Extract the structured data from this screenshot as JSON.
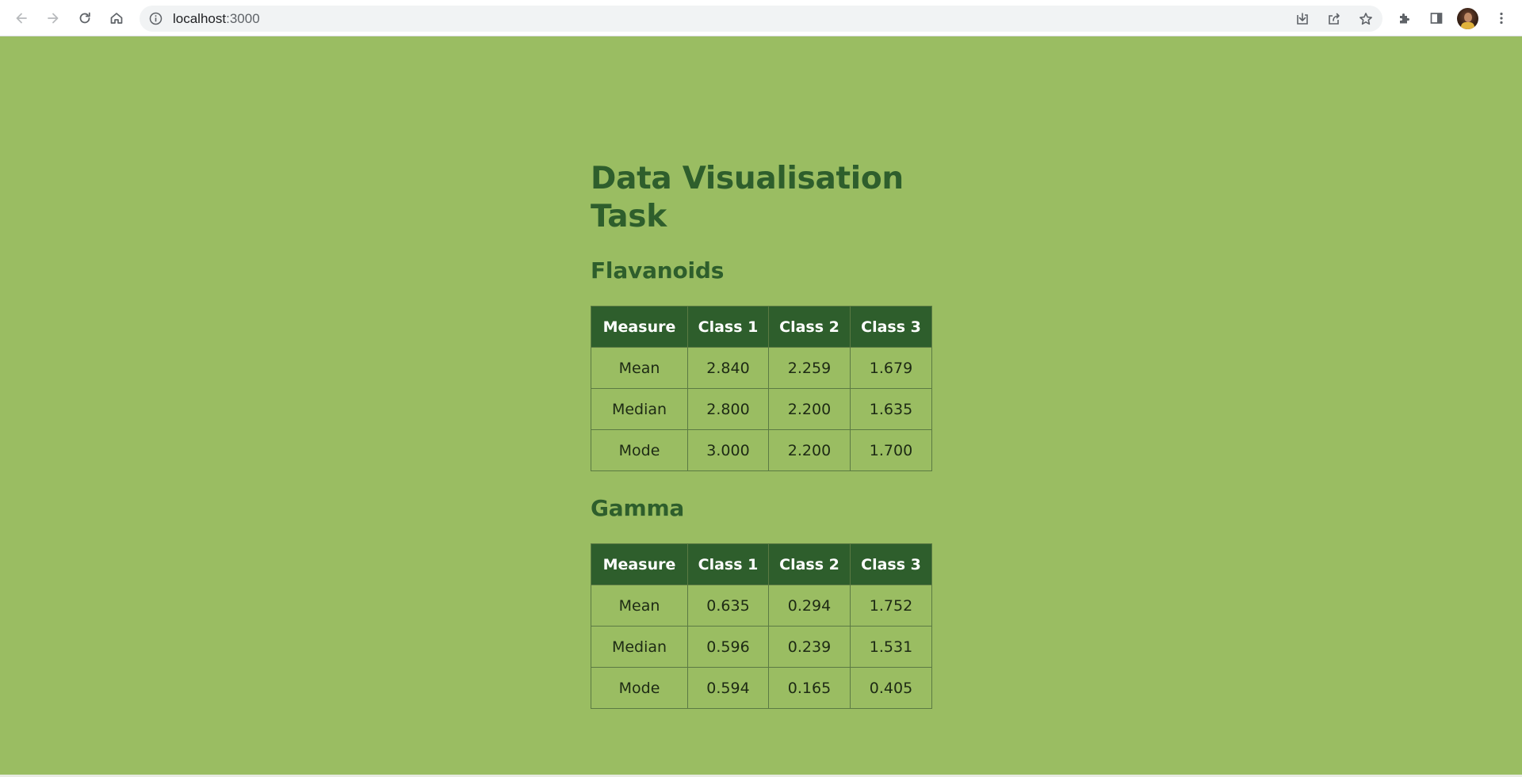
{
  "browser": {
    "url_host": "localhost",
    "url_port": ":3000",
    "icons": {
      "back": "arrow-left-icon",
      "forward": "arrow-right-icon",
      "reload": "reload-icon",
      "home": "home-icon",
      "site_info": "info-icon",
      "install": "install-icon",
      "share": "share-icon",
      "bookmark": "star-icon",
      "extensions": "puzzle-icon",
      "side_panel": "side-panel-icon",
      "menu": "kebab-menu-icon"
    }
  },
  "page": {
    "title": "Data Visualisation Task",
    "background_color": "#9abd62",
    "accent_color": "#2e5e2c",
    "sections": [
      {
        "title": "Flavanoids",
        "headers": [
          "Measure",
          "Class 1",
          "Class 2",
          "Class 3"
        ],
        "rows": [
          [
            "Mean",
            "2.840",
            "2.259",
            "1.679"
          ],
          [
            "Median",
            "2.800",
            "2.200",
            "1.635"
          ],
          [
            "Mode",
            "3.000",
            "2.200",
            "1.700"
          ]
        ]
      },
      {
        "title": "Gamma",
        "headers": [
          "Measure",
          "Class 1",
          "Class 2",
          "Class 3"
        ],
        "rows": [
          [
            "Mean",
            "0.635",
            "0.294",
            "1.752"
          ],
          [
            "Median",
            "0.596",
            "0.239",
            "1.531"
          ],
          [
            "Mode",
            "0.594",
            "0.165",
            "0.405"
          ]
        ]
      }
    ]
  }
}
